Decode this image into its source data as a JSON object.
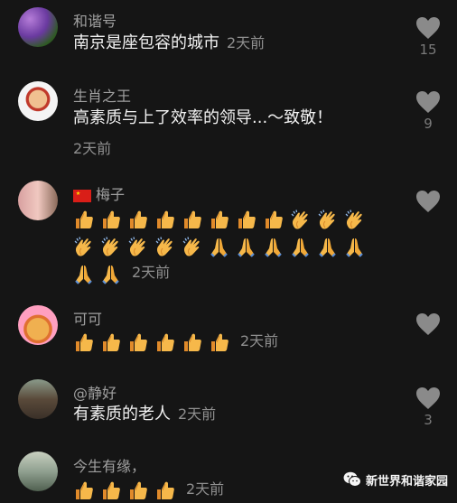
{
  "comments": [
    {
      "user": "和谐号",
      "text": "南京是座包容的城市",
      "time": "2天前",
      "likes": "15"
    },
    {
      "user": "生肖之王",
      "text": "高素质与上了效率的领导...～致敬！",
      "time": "2天前",
      "likes": "9"
    },
    {
      "user": "梅子",
      "time": "2天前",
      "likes": "",
      "emoji_rows": [
        [
          "thumbs-up",
          "thumbs-up",
          "thumbs-up",
          "thumbs-up",
          "thumbs-up",
          "thumbs-up",
          "thumbs-up",
          "thumbs-up",
          "clap",
          "clap",
          "clap"
        ],
        [
          "clap",
          "clap",
          "clap",
          "clap",
          "clap",
          "pray",
          "pray",
          "pray",
          "pray",
          "pray",
          "pray"
        ],
        [
          "pray",
          "pray"
        ]
      ]
    },
    {
      "user": "可可",
      "time": "2天前",
      "likes": "",
      "emoji_rows": [
        [
          "thumbs-up",
          "thumbs-up",
          "thumbs-up",
          "thumbs-up",
          "thumbs-up",
          "thumbs-up"
        ]
      ]
    },
    {
      "user": "@静好",
      "text": "有素质的老人",
      "time": "2天前",
      "likes": "3"
    },
    {
      "user": "今生有缘，",
      "time": "2天前",
      "likes": "",
      "emoji_rows": [
        [
          "thumbs-up",
          "thumbs-up",
          "thumbs-up",
          "thumbs-up"
        ]
      ]
    }
  ],
  "watermark": "新世界和谐家园",
  "icons": {
    "like": "heart-icon",
    "flag": "china-flag-icon",
    "watermark": "wechat-icon"
  },
  "colors": {
    "background": "#151515",
    "username": "#a0a0a0",
    "text": "#f2f2f2",
    "heart": "#8a8a8a"
  }
}
